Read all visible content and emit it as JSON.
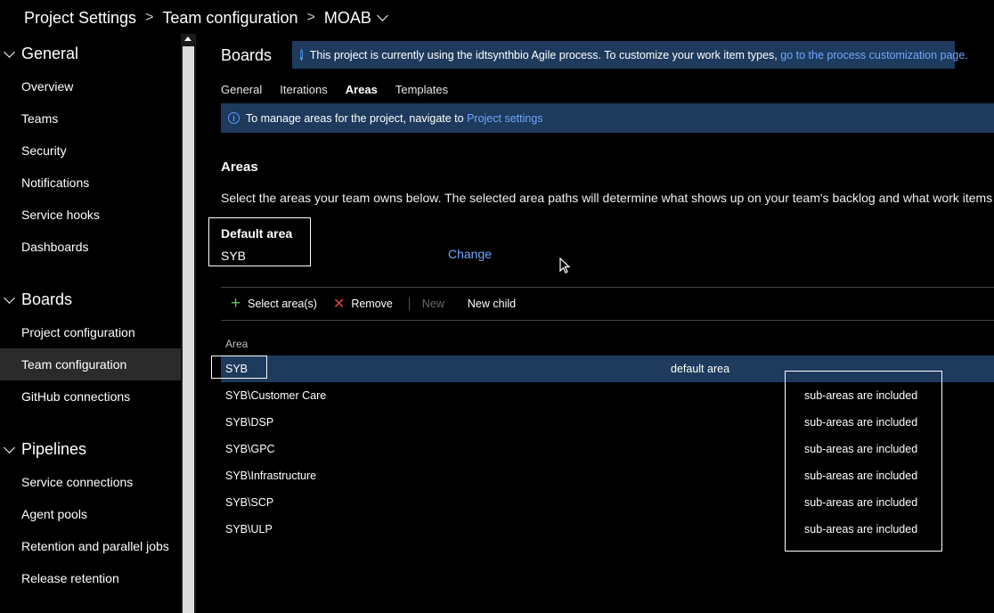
{
  "breadcrumb": {
    "root": "Project Settings",
    "section": "Team configuration",
    "team": "MOAB"
  },
  "sidebar": {
    "general": {
      "label": "General",
      "items": [
        {
          "label": "Overview"
        },
        {
          "label": "Teams"
        },
        {
          "label": "Security"
        },
        {
          "label": "Notifications"
        },
        {
          "label": "Service hooks"
        },
        {
          "label": "Dashboards"
        }
      ]
    },
    "boards": {
      "label": "Boards",
      "items": [
        {
          "label": "Project configuration"
        },
        {
          "label": "Team configuration"
        },
        {
          "label": "GitHub connections"
        }
      ]
    },
    "pipelines": {
      "label": "Pipelines",
      "items": [
        {
          "label": "Service connections"
        },
        {
          "label": "Agent pools"
        },
        {
          "label": "Retention and parallel jobs"
        },
        {
          "label": "Release retention"
        }
      ]
    },
    "selected_item": "Team configuration"
  },
  "main": {
    "title": "Boards",
    "process_banner": {
      "text": "This project is currently using the idtsynthbio Agile process. To customize your work item types,",
      "link": "go to the process customization page."
    },
    "tabs": [
      {
        "label": "General"
      },
      {
        "label": "Iterations"
      },
      {
        "label": "Areas"
      },
      {
        "label": "Templates"
      }
    ],
    "active_tab": "Areas",
    "message_bar": {
      "text": "To manage areas for the project, navigate to",
      "link": "Project settings"
    },
    "areas_heading": "Areas",
    "description": "Select the areas your team owns below. The selected area paths will determine what shows up on your team's backlog and what work items y",
    "default_area": {
      "label": "Default area",
      "value": "SYB",
      "change_label": "Change"
    },
    "toolbar": {
      "select": "Select area(s)",
      "remove": "Remove",
      "new": "New",
      "new_child": "New child"
    },
    "table": {
      "column": "Area",
      "rows": [
        {
          "path": "SYB",
          "note": "default area"
        },
        {
          "path": "SYB\\Customer Care",
          "note": "sub-areas are included"
        },
        {
          "path": "SYB\\DSP",
          "note": "sub-areas are included"
        },
        {
          "path": "SYB\\GPC",
          "note": "sub-areas are included"
        },
        {
          "path": "SYB\\Infrastructure",
          "note": "sub-areas are included"
        },
        {
          "path": "SYB\\SCP",
          "note": "sub-areas are included"
        },
        {
          "path": "SYB\\ULP",
          "note": "sub-areas are included"
        }
      ]
    }
  },
  "colors": {
    "accent": "#6ea8ff",
    "banner_bg": "#1e3a5c",
    "selected_row": "#1e3a5c",
    "add_green": "#5fc35f",
    "remove_red": "#e04343"
  },
  "icons": {
    "info": "info-circle-icon",
    "add": "plus-icon",
    "remove": "x-icon",
    "collapse": "chevron-down-icon"
  }
}
